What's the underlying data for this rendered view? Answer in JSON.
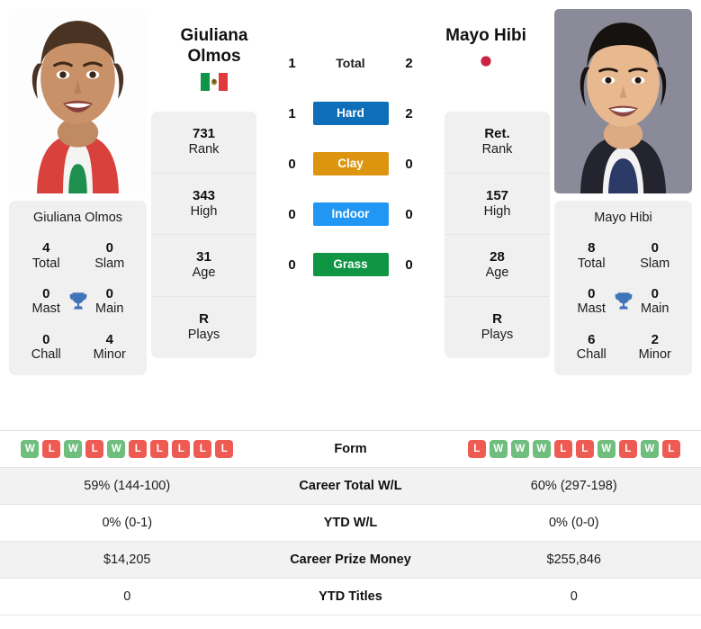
{
  "players": {
    "left": {
      "name_line1": "Giuliana",
      "name_line2": "Olmos",
      "full_name": "Giuliana Olmos",
      "country_flag_icon": "mexico-flag-icon",
      "stats": [
        {
          "value": "731",
          "label": "Rank"
        },
        {
          "value": "343",
          "label": "High"
        },
        {
          "value": "31",
          "label": "Age"
        },
        {
          "value": "R",
          "label": "Plays"
        }
      ],
      "titles": [
        {
          "value": "4",
          "label": "Total"
        },
        {
          "value": "0",
          "label": "Slam"
        },
        {
          "value": "0",
          "label": "Mast"
        },
        {
          "value": "0",
          "label": "Main"
        },
        {
          "value": "0",
          "label": "Chall"
        },
        {
          "value": "4",
          "label": "Minor"
        }
      ],
      "form": [
        "W",
        "L",
        "W",
        "L",
        "W",
        "L",
        "L",
        "L",
        "L",
        "L"
      ],
      "career_total_wl": "59% (144-100)",
      "ytd_wl": "0% (0-1)",
      "career_prize_money": "$14,205",
      "ytd_titles": "0"
    },
    "right": {
      "name_line1": "Mayo Hibi",
      "name_line2": "",
      "full_name": "Mayo Hibi",
      "country_flag_icon": "japan-flag-icon",
      "stats": [
        {
          "value": "Ret.",
          "label": "Rank"
        },
        {
          "value": "157",
          "label": "High"
        },
        {
          "value": "28",
          "label": "Age"
        },
        {
          "value": "R",
          "label": "Plays"
        }
      ],
      "titles": [
        {
          "value": "8",
          "label": "Total"
        },
        {
          "value": "0",
          "label": "Slam"
        },
        {
          "value": "0",
          "label": "Mast"
        },
        {
          "value": "0",
          "label": "Main"
        },
        {
          "value": "6",
          "label": "Chall"
        },
        {
          "value": "2",
          "label": "Minor"
        }
      ],
      "form": [
        "L",
        "W",
        "W",
        "W",
        "L",
        "L",
        "W",
        "L",
        "W",
        "L"
      ],
      "career_total_wl": "60% (297-198)",
      "ytd_wl": "0% (0-0)",
      "career_prize_money": "$255,846",
      "ytd_titles": "0"
    }
  },
  "head_to_head": [
    {
      "label": "Total",
      "left": "1",
      "right": "2",
      "color": ""
    },
    {
      "label": "Hard",
      "left": "1",
      "right": "2",
      "color": "#0e6eb8"
    },
    {
      "label": "Clay",
      "left": "0",
      "right": "0",
      "color": "#dd9510"
    },
    {
      "label": "Indoor",
      "left": "0",
      "right": "0",
      "color": "#2196f3"
    },
    {
      "label": "Grass",
      "left": "0",
      "right": "0",
      "color": "#0f9543"
    }
  ],
  "table": {
    "rows": [
      {
        "label": "Form"
      },
      {
        "label": "Career Total W/L"
      },
      {
        "label": "YTD W/L"
      },
      {
        "label": "Career Prize Money"
      },
      {
        "label": "YTD Titles"
      }
    ]
  },
  "colors": {
    "win": "#6fbe7e",
    "loss": "#ee5b53",
    "card_bg": "#f0f0f0",
    "row_alt_bg": "#f2f2f2"
  }
}
